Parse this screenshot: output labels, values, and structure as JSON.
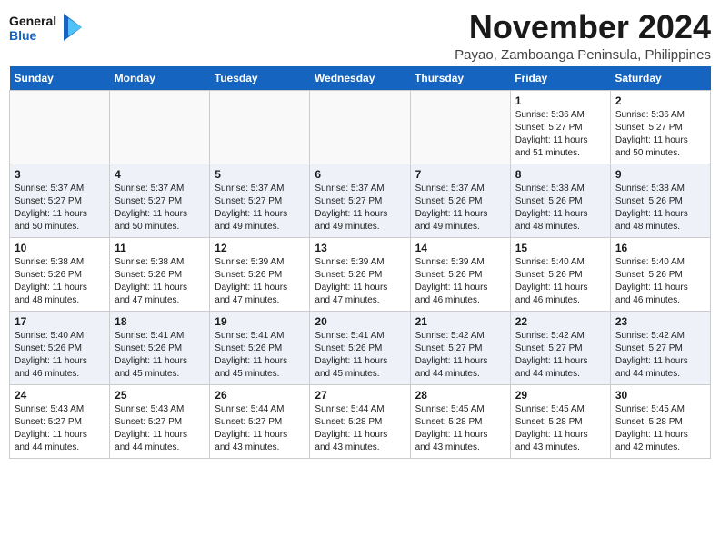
{
  "header": {
    "logo_general": "General",
    "logo_blue": "Blue",
    "month": "November 2024",
    "location": "Payao, Zamboanga Peninsula, Philippines"
  },
  "weekdays": [
    "Sunday",
    "Monday",
    "Tuesday",
    "Wednesday",
    "Thursday",
    "Friday",
    "Saturday"
  ],
  "weeks": [
    [
      {
        "day": "",
        "info": ""
      },
      {
        "day": "",
        "info": ""
      },
      {
        "day": "",
        "info": ""
      },
      {
        "day": "",
        "info": ""
      },
      {
        "day": "",
        "info": ""
      },
      {
        "day": "1",
        "info": "Sunrise: 5:36 AM\nSunset: 5:27 PM\nDaylight: 11 hours\nand 51 minutes."
      },
      {
        "day": "2",
        "info": "Sunrise: 5:36 AM\nSunset: 5:27 PM\nDaylight: 11 hours\nand 50 minutes."
      }
    ],
    [
      {
        "day": "3",
        "info": "Sunrise: 5:37 AM\nSunset: 5:27 PM\nDaylight: 11 hours\nand 50 minutes."
      },
      {
        "day": "4",
        "info": "Sunrise: 5:37 AM\nSunset: 5:27 PM\nDaylight: 11 hours\nand 50 minutes."
      },
      {
        "day": "5",
        "info": "Sunrise: 5:37 AM\nSunset: 5:27 PM\nDaylight: 11 hours\nand 49 minutes."
      },
      {
        "day": "6",
        "info": "Sunrise: 5:37 AM\nSunset: 5:27 PM\nDaylight: 11 hours\nand 49 minutes."
      },
      {
        "day": "7",
        "info": "Sunrise: 5:37 AM\nSunset: 5:26 PM\nDaylight: 11 hours\nand 49 minutes."
      },
      {
        "day": "8",
        "info": "Sunrise: 5:38 AM\nSunset: 5:26 PM\nDaylight: 11 hours\nand 48 minutes."
      },
      {
        "day": "9",
        "info": "Sunrise: 5:38 AM\nSunset: 5:26 PM\nDaylight: 11 hours\nand 48 minutes."
      }
    ],
    [
      {
        "day": "10",
        "info": "Sunrise: 5:38 AM\nSunset: 5:26 PM\nDaylight: 11 hours\nand 48 minutes."
      },
      {
        "day": "11",
        "info": "Sunrise: 5:38 AM\nSunset: 5:26 PM\nDaylight: 11 hours\nand 47 minutes."
      },
      {
        "day": "12",
        "info": "Sunrise: 5:39 AM\nSunset: 5:26 PM\nDaylight: 11 hours\nand 47 minutes."
      },
      {
        "day": "13",
        "info": "Sunrise: 5:39 AM\nSunset: 5:26 PM\nDaylight: 11 hours\nand 47 minutes."
      },
      {
        "day": "14",
        "info": "Sunrise: 5:39 AM\nSunset: 5:26 PM\nDaylight: 11 hours\nand 46 minutes."
      },
      {
        "day": "15",
        "info": "Sunrise: 5:40 AM\nSunset: 5:26 PM\nDaylight: 11 hours\nand 46 minutes."
      },
      {
        "day": "16",
        "info": "Sunrise: 5:40 AM\nSunset: 5:26 PM\nDaylight: 11 hours\nand 46 minutes."
      }
    ],
    [
      {
        "day": "17",
        "info": "Sunrise: 5:40 AM\nSunset: 5:26 PM\nDaylight: 11 hours\nand 46 minutes."
      },
      {
        "day": "18",
        "info": "Sunrise: 5:41 AM\nSunset: 5:26 PM\nDaylight: 11 hours\nand 45 minutes."
      },
      {
        "day": "19",
        "info": "Sunrise: 5:41 AM\nSunset: 5:26 PM\nDaylight: 11 hours\nand 45 minutes."
      },
      {
        "day": "20",
        "info": "Sunrise: 5:41 AM\nSunset: 5:26 PM\nDaylight: 11 hours\nand 45 minutes."
      },
      {
        "day": "21",
        "info": "Sunrise: 5:42 AM\nSunset: 5:27 PM\nDaylight: 11 hours\nand 44 minutes."
      },
      {
        "day": "22",
        "info": "Sunrise: 5:42 AM\nSunset: 5:27 PM\nDaylight: 11 hours\nand 44 minutes."
      },
      {
        "day": "23",
        "info": "Sunrise: 5:42 AM\nSunset: 5:27 PM\nDaylight: 11 hours\nand 44 minutes."
      }
    ],
    [
      {
        "day": "24",
        "info": "Sunrise: 5:43 AM\nSunset: 5:27 PM\nDaylight: 11 hours\nand 44 minutes."
      },
      {
        "day": "25",
        "info": "Sunrise: 5:43 AM\nSunset: 5:27 PM\nDaylight: 11 hours\nand 44 minutes."
      },
      {
        "day": "26",
        "info": "Sunrise: 5:44 AM\nSunset: 5:27 PM\nDaylight: 11 hours\nand 43 minutes."
      },
      {
        "day": "27",
        "info": "Sunrise: 5:44 AM\nSunset: 5:28 PM\nDaylight: 11 hours\nand 43 minutes."
      },
      {
        "day": "28",
        "info": "Sunrise: 5:45 AM\nSunset: 5:28 PM\nDaylight: 11 hours\nand 43 minutes."
      },
      {
        "day": "29",
        "info": "Sunrise: 5:45 AM\nSunset: 5:28 PM\nDaylight: 11 hours\nand 43 minutes."
      },
      {
        "day": "30",
        "info": "Sunrise: 5:45 AM\nSunset: 5:28 PM\nDaylight: 11 hours\nand 42 minutes."
      }
    ]
  ]
}
